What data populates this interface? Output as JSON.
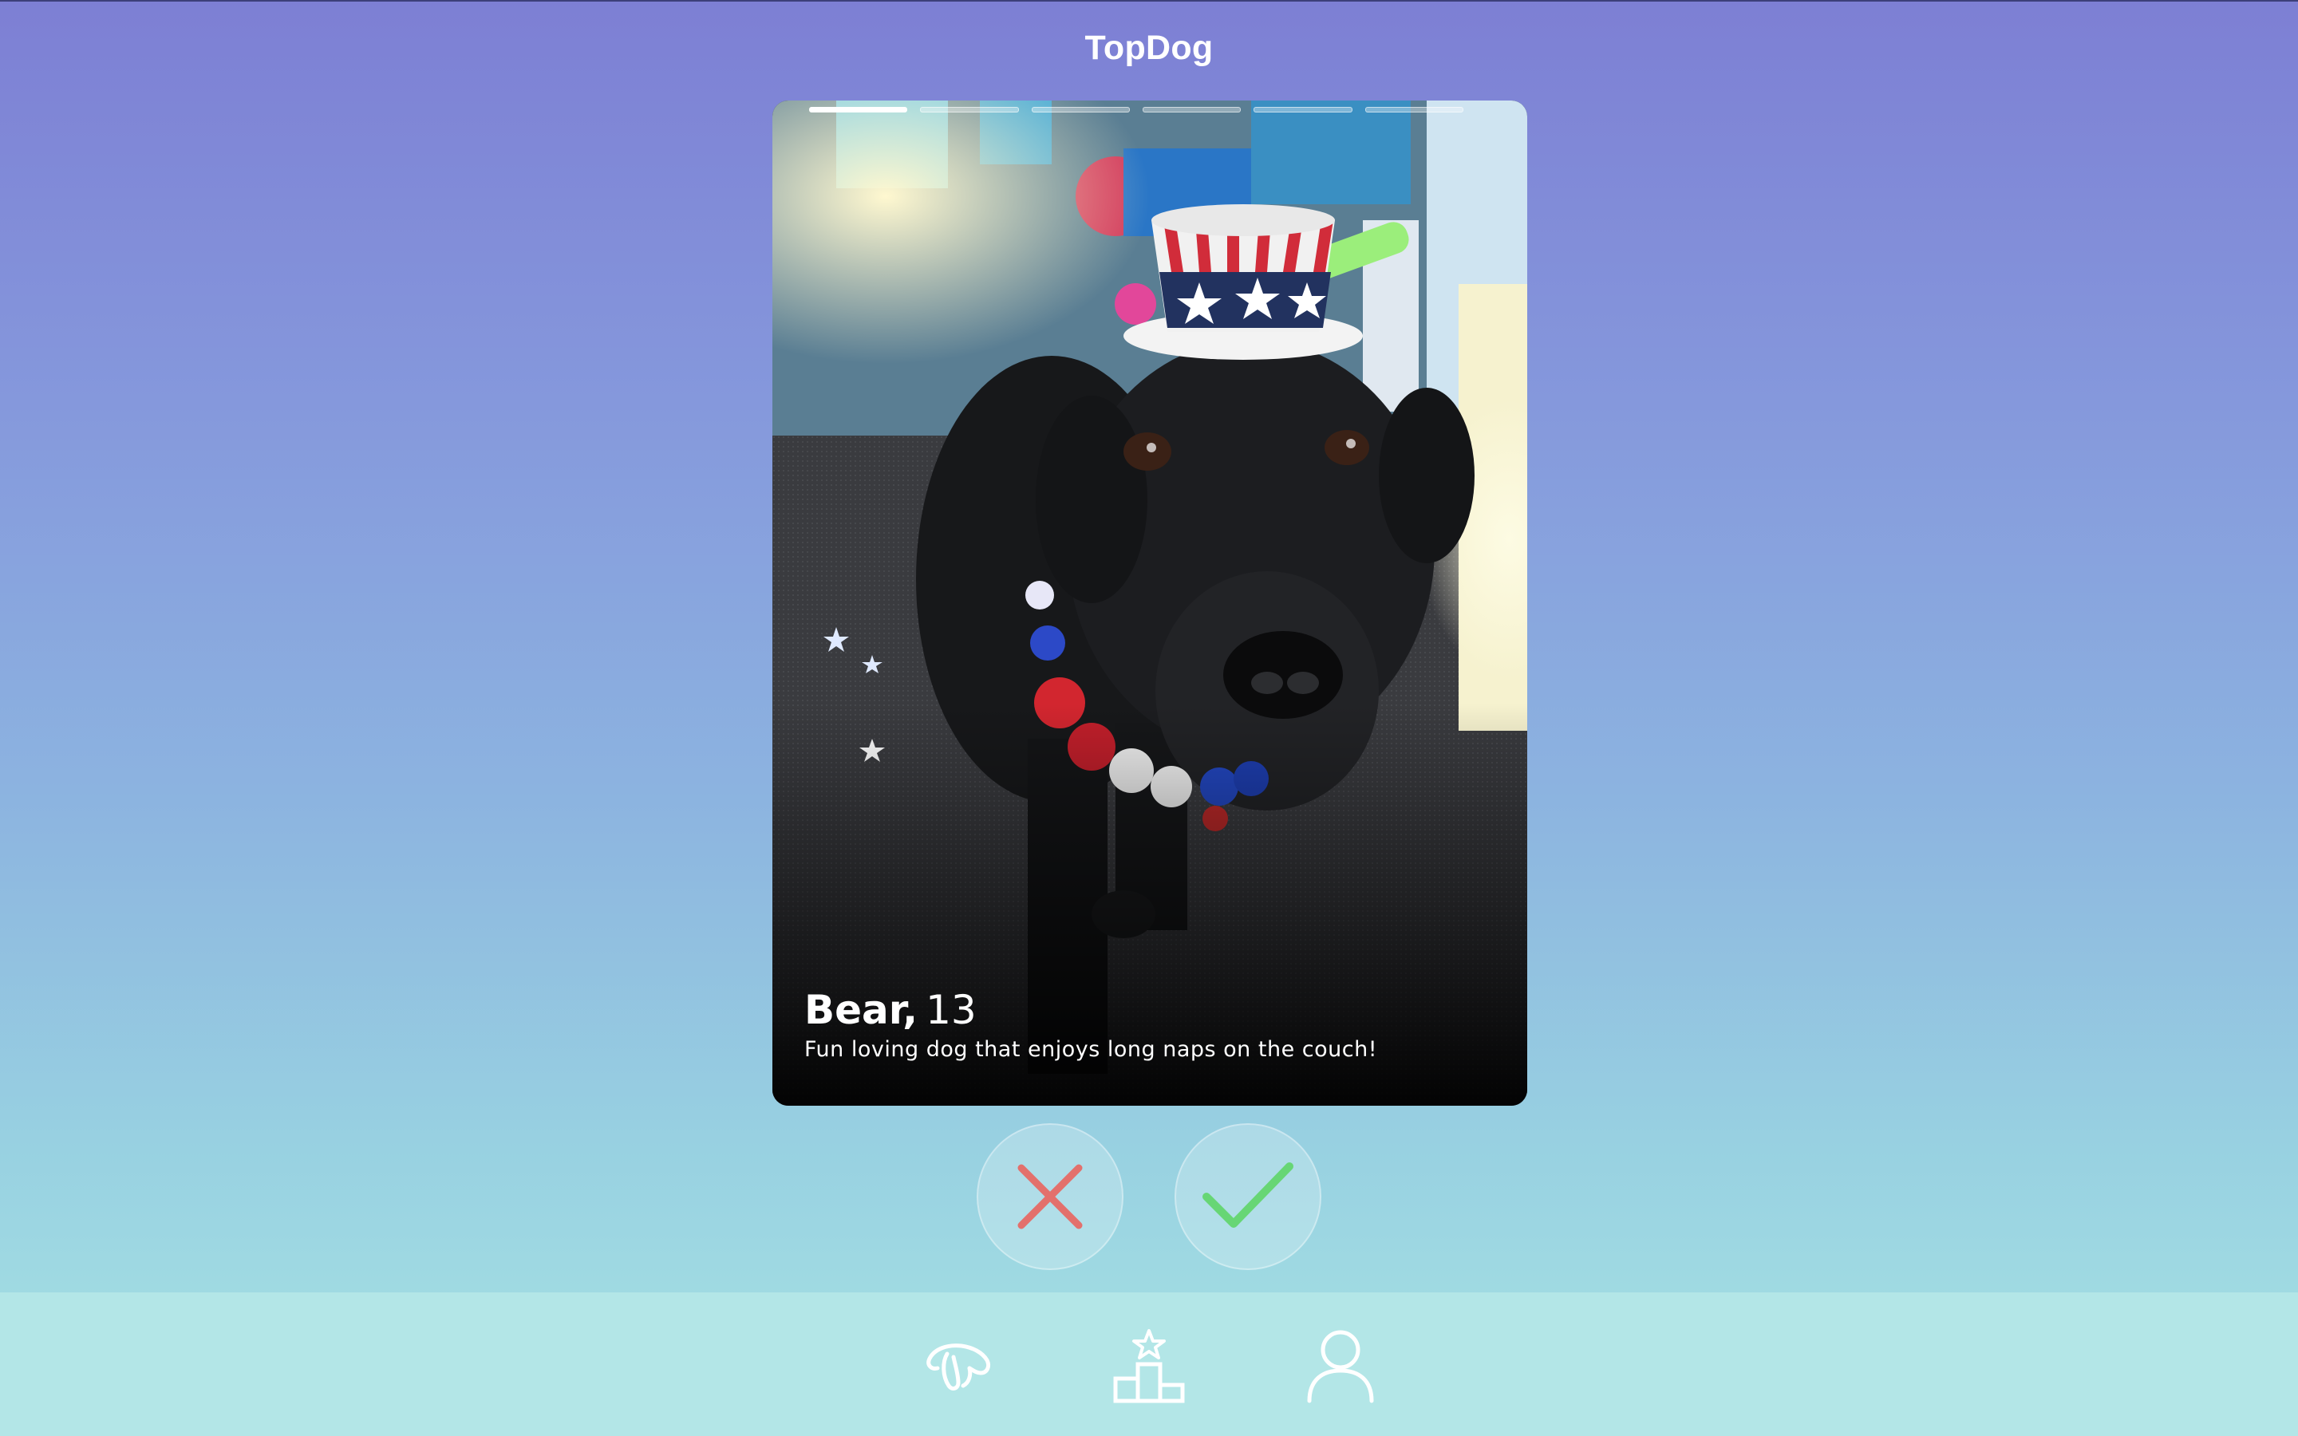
{
  "header": {
    "title": "TopDog"
  },
  "card": {
    "photo_count": 6,
    "active_photo_index": 0,
    "name": "Bear,",
    "age": "13",
    "bio": "Fun loving dog that enjoys long naps on the couch!"
  },
  "actions": {
    "reject_icon": "x-icon",
    "like_icon": "checkmark-icon",
    "reject_color": "#e3706c",
    "like_color": "#67d675"
  },
  "nav": {
    "items": [
      {
        "icon": "dog-icon"
      },
      {
        "icon": "podium-star-icon"
      },
      {
        "icon": "user-icon"
      }
    ]
  },
  "colors": {
    "gradient_top": "#7d7fd4",
    "gradient_bottom": "#a7e3e4",
    "nav_background": "#b3e6e7"
  }
}
